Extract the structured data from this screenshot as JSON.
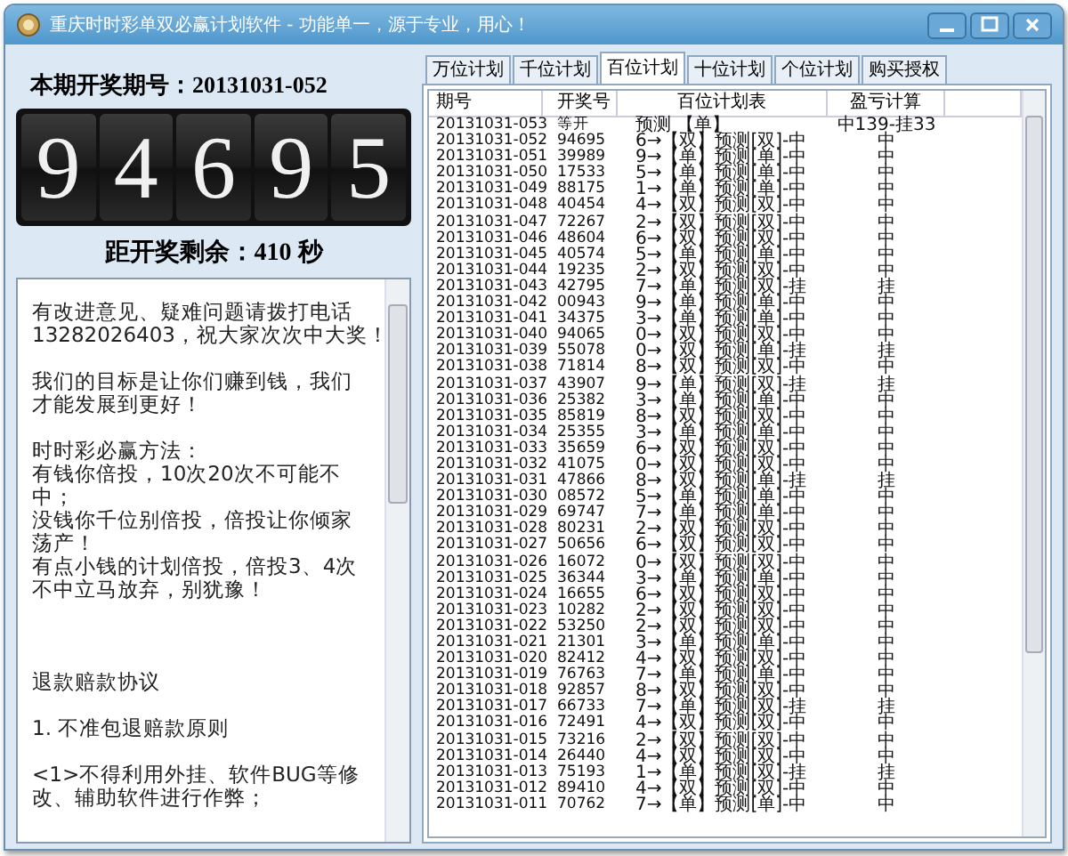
{
  "window": {
    "title": "重庆时时彩单双必赢计划软件 - 功能单一，源于专业，用心！"
  },
  "left": {
    "period_label": "本期开奖期号：20131031-052",
    "digits": [
      "9",
      "4",
      "6",
      "9",
      "5"
    ],
    "countdown": "距开奖剩余：410 秒",
    "notice": [
      {
        "kind": "text",
        "lines": [
          "有改进意见、疑难问题请拨打电话",
          "13282026403，祝大家次次中大奖！"
        ]
      },
      {
        "kind": "text",
        "lines": [
          "我们的目标是让你们赚到钱，我们",
          "才能发展到更好！"
        ]
      },
      {
        "kind": "text",
        "lines": [
          "时时彩必赢方法：",
          "有钱你倍投，10次20次不可能不",
          "中；",
          "没钱你千位别倍投，倍投让你倾家",
          "荡产！",
          "有点小钱的计划倍投，倍投3、4次",
          "不中立马放弃，别犹豫！"
        ]
      },
      {
        "kind": "heading",
        "lines": [
          "退款赔款协议"
        ]
      },
      {
        "kind": "text",
        "lines": [
          "1. 不准包退赔款原则"
        ]
      },
      {
        "kind": "text",
        "lines": [
          "<1>不得利用外挂、软件BUG等修",
          "改、辅助软件进行作弊；"
        ]
      }
    ]
  },
  "tabs": [
    {
      "label": "万位计划",
      "selected": false
    },
    {
      "label": "千位计划",
      "selected": false
    },
    {
      "label": "百位计划",
      "selected": true
    },
    {
      "label": "十位计划",
      "selected": false
    },
    {
      "label": "个位计划",
      "selected": false
    },
    {
      "label": "购买授权",
      "selected": false
    }
  ],
  "table": {
    "columns": [
      "期号",
      "开奖号",
      "百位计划表",
      "盈亏计算"
    ],
    "rows": [
      {
        "period": "20131031-053",
        "number": "等开",
        "plan": "预测 【单】",
        "result": "中139-挂33"
      },
      {
        "period": "20131031-052",
        "number": "94695",
        "plan": "6→【双】预测[双]-中",
        "result": "中"
      },
      {
        "period": "20131031-051",
        "number": "39989",
        "plan": "9→【单】预测[单]-中",
        "result": "中"
      },
      {
        "period": "20131031-050",
        "number": "17533",
        "plan": "5→【单】预测[单]-中",
        "result": "中"
      },
      {
        "period": "20131031-049",
        "number": "88175",
        "plan": "1→【单】预测[单]-中",
        "result": "中"
      },
      {
        "period": "20131031-048",
        "number": "40454",
        "plan": "4→【双】预测[双]-中",
        "result": "中"
      },
      {
        "period": "20131031-047",
        "number": "72267",
        "plan": "2→【双】预测[双]-中",
        "result": "中"
      },
      {
        "period": "20131031-046",
        "number": "48604",
        "plan": "6→【双】预测[双]-中",
        "result": "中"
      },
      {
        "period": "20131031-045",
        "number": "40574",
        "plan": "5→【单】预测[单]-中",
        "result": "中"
      },
      {
        "period": "20131031-044",
        "number": "19235",
        "plan": "2→【双】预测[双]-中",
        "result": "中"
      },
      {
        "period": "20131031-043",
        "number": "42795",
        "plan": "7→【单】预测[双]-挂",
        "result": "挂"
      },
      {
        "period": "20131031-042",
        "number": "00943",
        "plan": "9→【单】预测[单]-中",
        "result": "中"
      },
      {
        "period": "20131031-041",
        "number": "34375",
        "plan": "3→【单】预测[单]-中",
        "result": "中"
      },
      {
        "period": "20131031-040",
        "number": "94065",
        "plan": "0→【双】预测[双]-中",
        "result": "中"
      },
      {
        "period": "20131031-039",
        "number": "55078",
        "plan": "0→【双】预测[单]-挂",
        "result": "挂"
      },
      {
        "period": "20131031-038",
        "number": "71814",
        "plan": "8→【双】预测[双]-中",
        "result": "中"
      },
      {
        "period": "20131031-037",
        "number": "43907",
        "plan": "9→【单】预测[双]-挂",
        "result": "挂"
      },
      {
        "period": "20131031-036",
        "number": "25382",
        "plan": "3→【单】预测[单]-中",
        "result": "中"
      },
      {
        "period": "20131031-035",
        "number": "85819",
        "plan": "8→【双】预测[双]-中",
        "result": "中"
      },
      {
        "period": "20131031-034",
        "number": "25355",
        "plan": "3→【单】预测[单]-中",
        "result": "中"
      },
      {
        "period": "20131031-033",
        "number": "35659",
        "plan": "6→【双】预测[双]-中",
        "result": "中"
      },
      {
        "period": "20131031-032",
        "number": "41075",
        "plan": "0→【双】预测[双]-中",
        "result": "中"
      },
      {
        "period": "20131031-031",
        "number": "47866",
        "plan": "8→【双】预测[单]-挂",
        "result": "挂"
      },
      {
        "period": "20131031-030",
        "number": "08572",
        "plan": "5→【单】预测[单]-中",
        "result": "中"
      },
      {
        "period": "20131031-029",
        "number": "69747",
        "plan": "7→【单】预测[单]-中",
        "result": "中"
      },
      {
        "period": "20131031-028",
        "number": "80231",
        "plan": "2→【双】预测[双]-中",
        "result": "中"
      },
      {
        "period": "20131031-027",
        "number": "50656",
        "plan": "6→【双】预测[双]-中",
        "result": "中"
      },
      {
        "period": "20131031-026",
        "number": "16072",
        "plan": "0→【双】预测[双]-中",
        "result": "中"
      },
      {
        "period": "20131031-025",
        "number": "36344",
        "plan": "3→【单】预测[单]-中",
        "result": "中"
      },
      {
        "period": "20131031-024",
        "number": "16655",
        "plan": "6→【双】预测[双]-中",
        "result": "中"
      },
      {
        "period": "20131031-023",
        "number": "10282",
        "plan": "2→【双】预测[双]-中",
        "result": "中"
      },
      {
        "period": "20131031-022",
        "number": "53250",
        "plan": "2→【双】预测[双]-中",
        "result": "中"
      },
      {
        "period": "20131031-021",
        "number": "21301",
        "plan": "3→【单】预测[单]-中",
        "result": "中"
      },
      {
        "period": "20131031-020",
        "number": "82412",
        "plan": "4→【双】预测[双]-中",
        "result": "中"
      },
      {
        "period": "20131031-019",
        "number": "76763",
        "plan": "7→【单】预测[单]-中",
        "result": "中"
      },
      {
        "period": "20131031-018",
        "number": "92857",
        "plan": "8→【双】预测[双]-中",
        "result": "中"
      },
      {
        "period": "20131031-017",
        "number": "66733",
        "plan": "7→【单】预测[双]-挂",
        "result": "挂"
      },
      {
        "period": "20131031-016",
        "number": "72491",
        "plan": "4→【双】预测[双]-中",
        "result": "中"
      },
      {
        "period": "20131031-015",
        "number": "73216",
        "plan": "2→【双】预测[双]-中",
        "result": "中"
      },
      {
        "period": "20131031-014",
        "number": "26440",
        "plan": "4→【双】预测[双]-中",
        "result": "中"
      },
      {
        "period": "20131031-013",
        "number": "75193",
        "plan": "1→【单】预测[双]-挂",
        "result": "挂"
      },
      {
        "period": "20131031-012",
        "number": "89410",
        "plan": "4→【双】预测[双]-中",
        "result": "中"
      },
      {
        "period": "20131031-011",
        "number": "70762",
        "plan": "7→【单】预测[单]-中",
        "result": "中"
      }
    ]
  }
}
